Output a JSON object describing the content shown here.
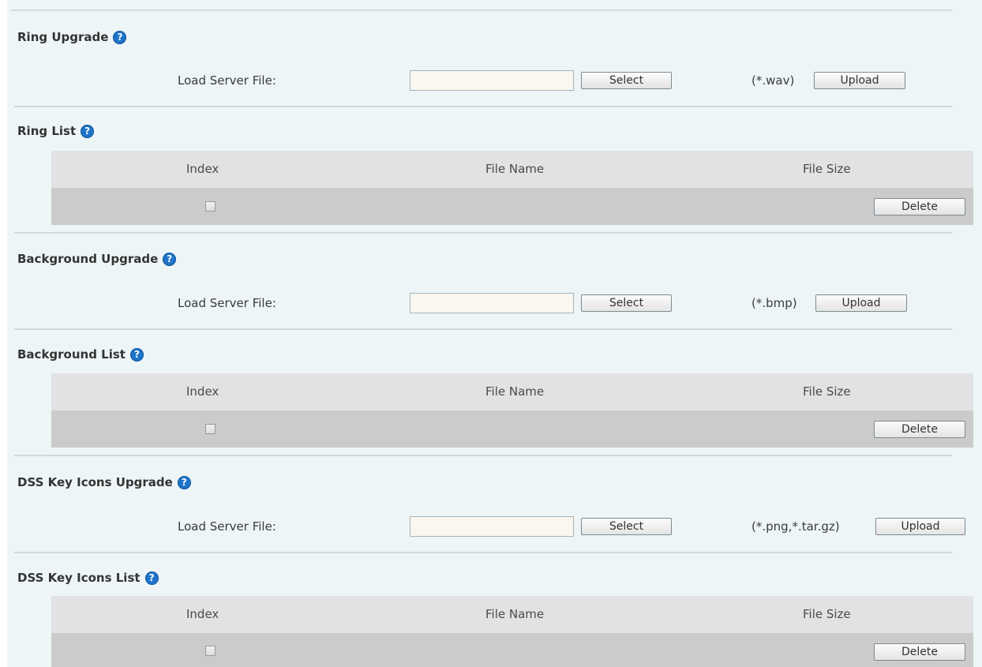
{
  "sections": {
    "ring_upgrade": {
      "title": "Ring Upgrade",
      "label": "Load Server File:",
      "input_value": "",
      "select_label": "Select",
      "ext": "(*.wav)",
      "upload_label": "Upload"
    },
    "ring_list": {
      "title": "Ring List",
      "columns": [
        "Index",
        "File Name",
        "File Size"
      ],
      "delete_label": "Delete"
    },
    "background_upgrade": {
      "title": "Background Upgrade",
      "label": "Load Server File:",
      "input_value": "",
      "select_label": "Select",
      "ext": "(*.bmp)",
      "upload_label": "Upload"
    },
    "background_list": {
      "title": "Background List",
      "columns": [
        "Index",
        "File Name",
        "File Size"
      ],
      "delete_label": "Delete"
    },
    "dss_upgrade": {
      "title": "DSS Key Icons Upgrade",
      "label": "Load Server File:",
      "input_value": "",
      "select_label": "Select",
      "ext": "(*.png,*.tar.gz)",
      "upload_label": "Upload"
    },
    "dss_list": {
      "title": "DSS Key Icons List",
      "columns": [
        "Index",
        "File Name",
        "File Size"
      ],
      "delete_label": "Delete"
    }
  },
  "icons": {
    "help": "help-icon"
  },
  "colors": {
    "panel_bg": "#eef5f7",
    "help_icon": "#1f74c9",
    "input_bg": "#f9f7ee",
    "table_header_bg": "#e1e2e3",
    "table_row_bg": "#cbcbcb"
  }
}
